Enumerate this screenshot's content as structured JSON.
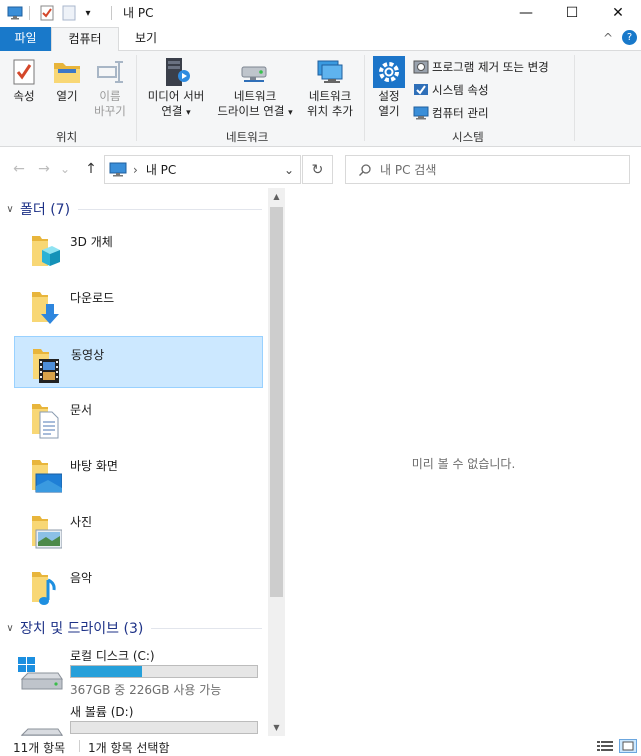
{
  "window": {
    "title": "내 PC",
    "minimize_glyph": "—",
    "maximize_glyph": "☐",
    "close_glyph": "✕"
  },
  "ribbon_tabs": {
    "file": "파일",
    "computer": "컴퓨터",
    "view": "보기",
    "collapse_glyph": "^",
    "help_glyph": "?"
  },
  "ribbon": {
    "location": {
      "properties": "속성",
      "open": "열기",
      "rename_line1": "이름",
      "rename_line2": "바꾸기",
      "group_label": "위치"
    },
    "network": {
      "media_line1": "미디어 서버",
      "media_line2": "연결",
      "map_drive_line1": "네트워크",
      "map_drive_line2": "드라이브 연결",
      "add_location_line1": "네트워크",
      "add_location_line2": "위치 추가",
      "group_label": "네트워크"
    },
    "system": {
      "settings_line1": "설정",
      "settings_line2": "열기",
      "uninstall": "프로그램 제거 또는 변경",
      "system_properties": "시스템 속성",
      "manage": "컴퓨터 관리",
      "group_label": "시스템"
    },
    "dropdown_glyph": "▾"
  },
  "nav": {
    "back_glyph": "←",
    "forward_glyph": "→",
    "recent_glyph": "⌄",
    "up_glyph": "↑",
    "breadcrumb_sep": "›",
    "path": "내 PC",
    "refresh_glyph": "↻",
    "search_placeholder": "내 PC 검색"
  },
  "groups": {
    "folders_title": "폴더 (7)",
    "devices_title": "장치 및 드라이브 (3)"
  },
  "folders": [
    {
      "name": "3D 개체",
      "icon": "3d-objects-folder-icon"
    },
    {
      "name": "다운로드",
      "icon": "downloads-folder-icon"
    },
    {
      "name": "동영상",
      "icon": "videos-folder-icon"
    },
    {
      "name": "문서",
      "icon": "documents-folder-icon"
    },
    {
      "name": "바탕 화면",
      "icon": "desktop-folder-icon"
    },
    {
      "name": "사진",
      "icon": "pictures-folder-icon"
    },
    {
      "name": "음악",
      "icon": "music-folder-icon"
    }
  ],
  "drives": [
    {
      "name": "로컬 디스크 (C:)",
      "info": "367GB 중 226GB 사용 가능",
      "used_fraction": 0.38
    },
    {
      "name": "새 볼륨 (D:)",
      "info": "",
      "used_fraction": 0.0
    }
  ],
  "preview": {
    "message": "미리 볼 수 없습니다."
  },
  "status": {
    "count": "11개 항목",
    "selected": "1개 항목 선택함"
  },
  "colors": {
    "accent": "#1979ca",
    "selection": "#cce8ff",
    "group_text": "#1e3287",
    "drive_fill": "#26a0da"
  }
}
